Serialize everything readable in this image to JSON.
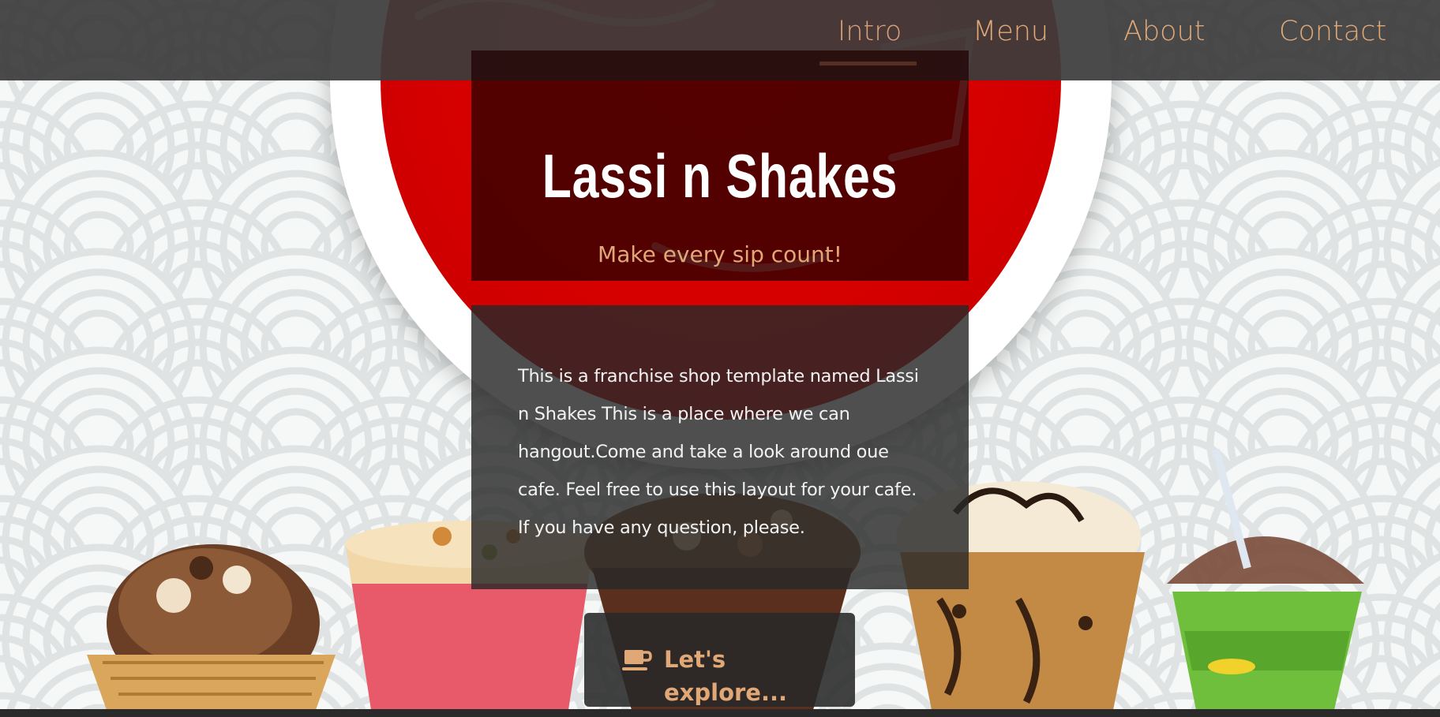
{
  "nav": {
    "items": [
      {
        "label": "Intro",
        "active": true
      },
      {
        "label": "Menu",
        "active": false
      },
      {
        "label": "About",
        "active": false
      },
      {
        "label": "Contact",
        "active": false
      }
    ]
  },
  "hero": {
    "title": "Lassi n Shakes",
    "tagline": "Make every sip count!"
  },
  "intro": {
    "text": "This is a franchise shop template named Lassi n Shakes This is a place where we can hangout.Come and take a look around oue cafe. Feel free to use this layout for your cafe. If you have any question, please."
  },
  "cta": {
    "label": "Let's explore...",
    "icon": "coffee-cup-icon"
  },
  "colors": {
    "accent": "#e0a877",
    "nav_bg": "#3c3c3c",
    "logo_red": "#d40000"
  }
}
